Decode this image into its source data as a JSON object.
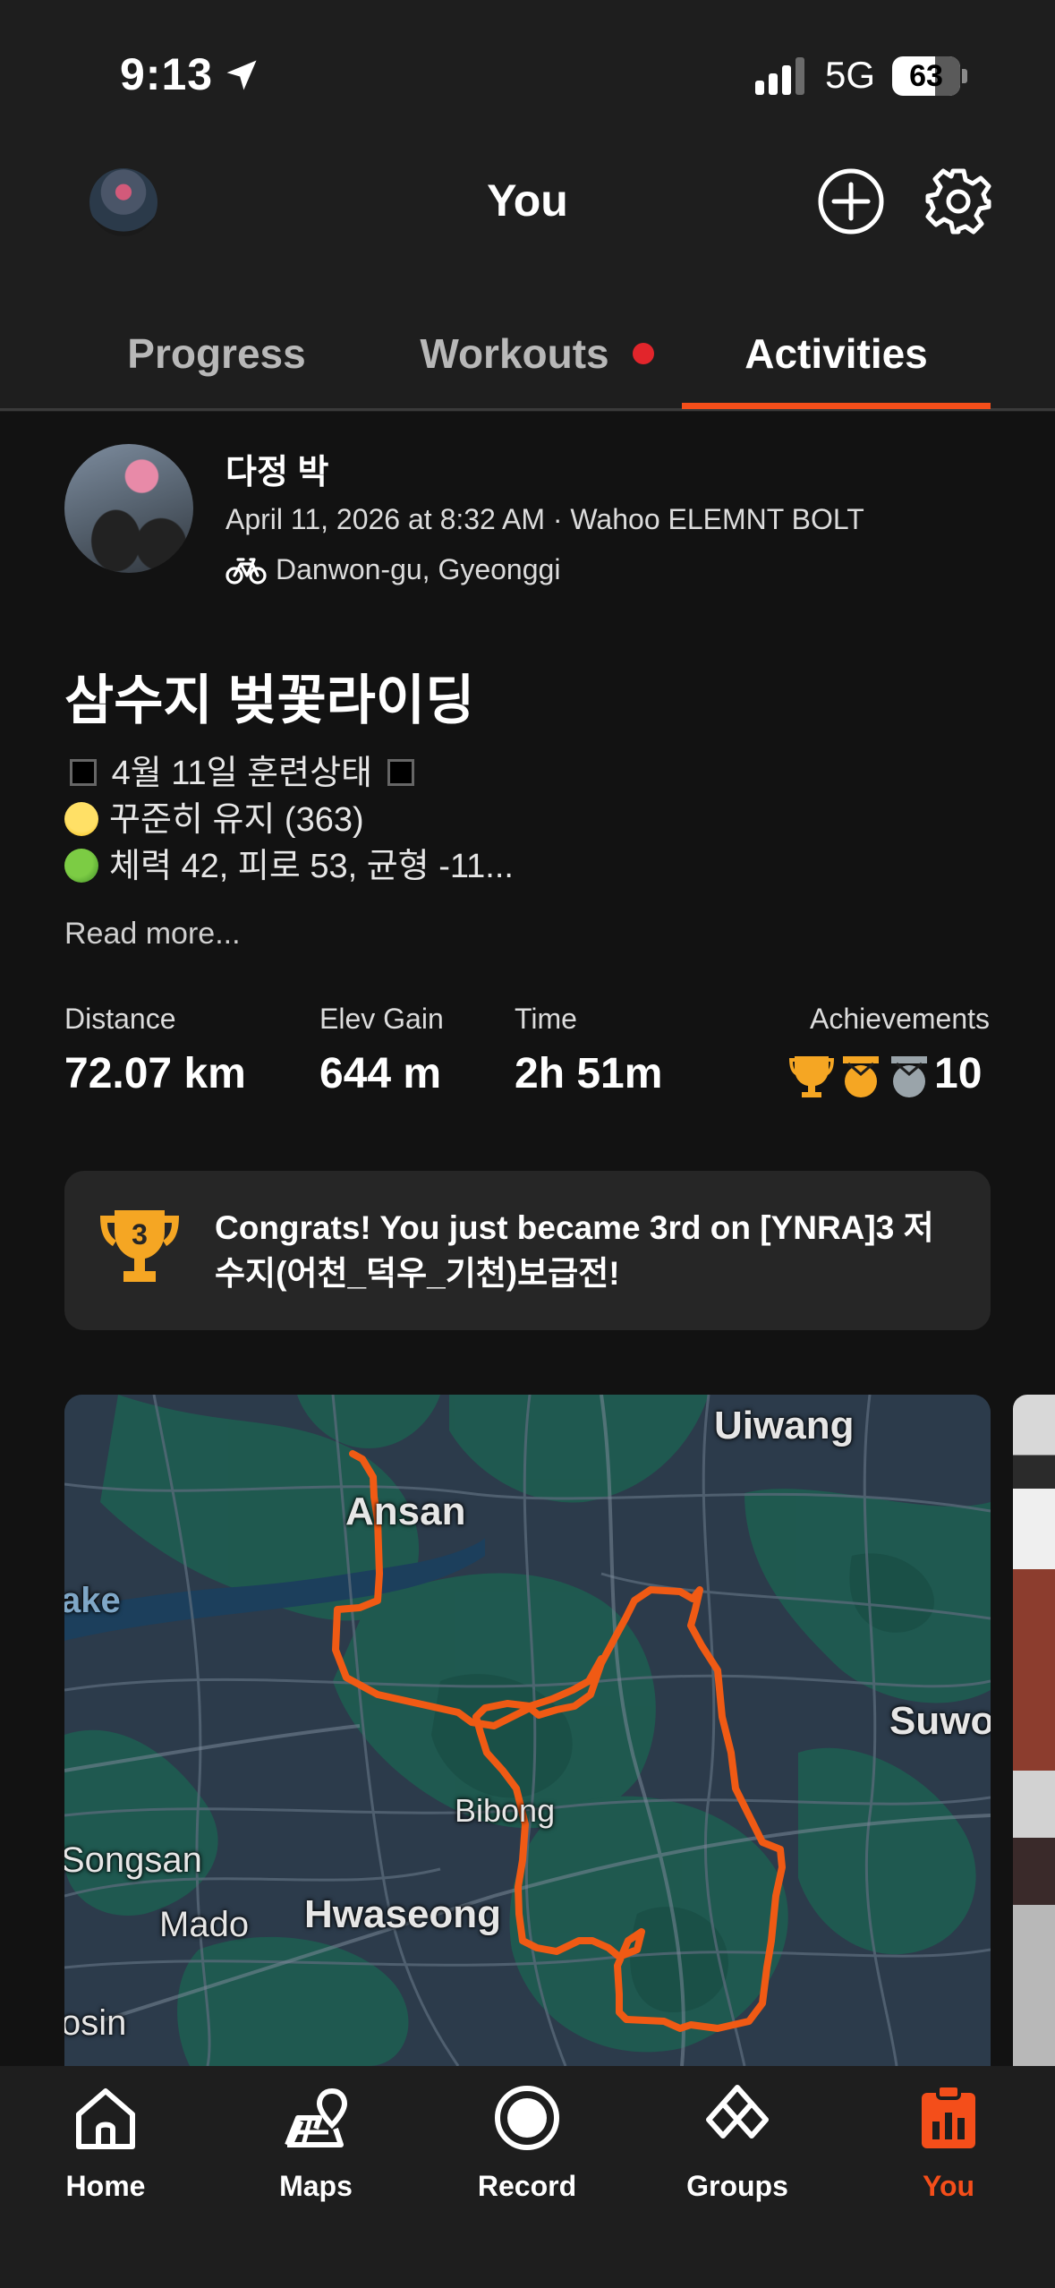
{
  "status_bar": {
    "time": "9:13",
    "network": "5G",
    "battery": "63",
    "battery_level": 0.63
  },
  "header": {
    "title": "You",
    "tabs": [
      {
        "label": "Progress",
        "active": false
      },
      {
        "label": "Workouts",
        "active": false,
        "has_notification_dot": true
      },
      {
        "label": "Activities",
        "active": true
      }
    ]
  },
  "activity": {
    "athlete_name": "다정 박",
    "meta": "April 11, 2026 at 8:32 AM · Wahoo ELEMNT BOLT",
    "location": "Danwon-gu, Gyeonggi",
    "title": "삼수지 벚꽃라이딩",
    "description": {
      "line1": "4월 11일 훈련상태",
      "line2": "꾸준히 유지 (363)",
      "line3": "체력 42, 피로 53, 균형 -11..."
    },
    "read_more": "Read more...",
    "stats": [
      {
        "label": "Distance",
        "value": "72.07 km"
      },
      {
        "label": "Elev Gain",
        "value": "644 m"
      },
      {
        "label": "Time",
        "value": "2h 51m"
      }
    ],
    "achievements": {
      "label": "Achievements",
      "count": "10"
    },
    "congrats": {
      "rank": "3",
      "text": "Congrats! You just became 3rd on [YNRA]3 저수지(어천_덕우_기천)보급전!"
    },
    "map": {
      "labels": [
        "Uiwang",
        "Ansan",
        "ake",
        "Suwo",
        "Bibong",
        "Songsan",
        "Hwaseong",
        "Mado",
        "osin"
      ],
      "route_color": "#f05a14"
    }
  },
  "bottom_nav": [
    {
      "label": "Home",
      "icon": "home-icon",
      "active": false
    },
    {
      "label": "Maps",
      "icon": "maps-icon",
      "active": false
    },
    {
      "label": "Record",
      "icon": "record-icon",
      "active": false
    },
    {
      "label": "Groups",
      "icon": "groups-icon",
      "active": false
    },
    {
      "label": "You",
      "icon": "you-icon",
      "active": true
    }
  ],
  "colors": {
    "accent": "#f44e1a",
    "background": "#121212",
    "header_bg": "#1e1e1e",
    "notification": "#e2252b",
    "trophy_gold": "#f5a623"
  }
}
